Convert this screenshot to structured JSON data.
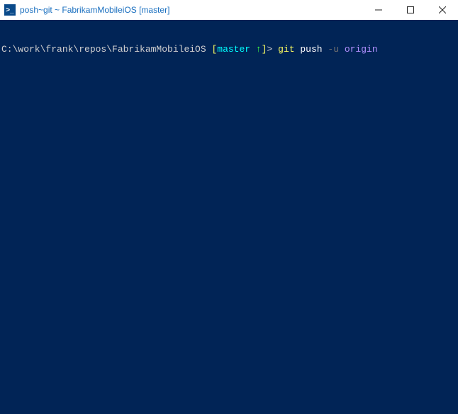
{
  "titlebar": {
    "icon_label": ">_",
    "title": "posh~git ~ FabrikamMobileiOS [master]"
  },
  "controls": {
    "minimize": "Minimize",
    "maximize": "Maximize",
    "close": "Close"
  },
  "prompt": {
    "path": "C:\\work\\frank\\repos\\FabrikamMobileiOS",
    "branch": "master",
    "ahead_indicator": "↑",
    "gt": ">",
    "command": "git",
    "arg_push": "push",
    "flag": "-u",
    "arg_remote": "origin"
  }
}
